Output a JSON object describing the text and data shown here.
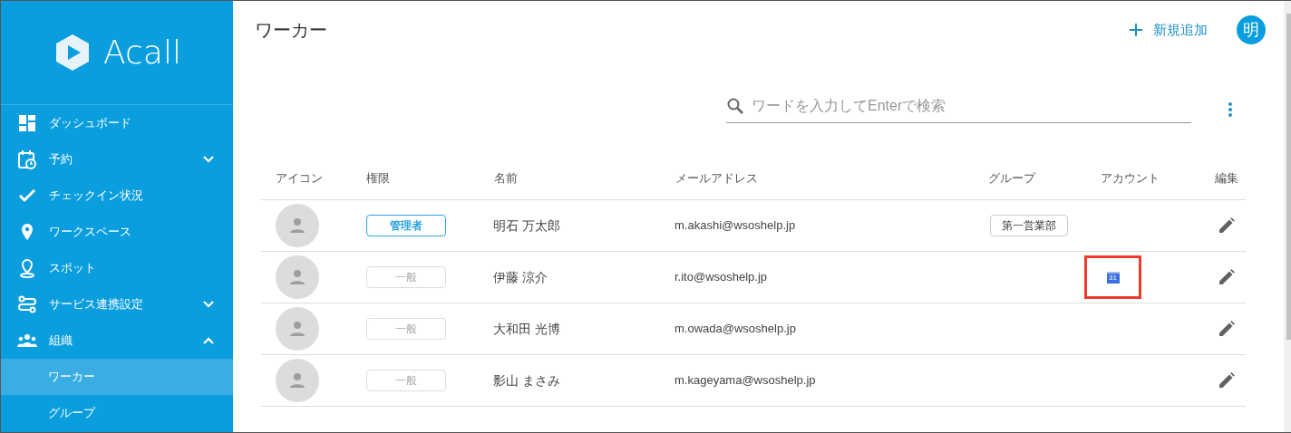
{
  "sidebar": {
    "logo": {
      "text": "Acall"
    },
    "items": [
      {
        "label": "ダッシュボード",
        "selected": false
      },
      {
        "label": "予約",
        "expanded": false,
        "selected": false
      },
      {
        "label": "チェックイン状況",
        "selected": false
      },
      {
        "label": "ワークスペース",
        "selected": false
      },
      {
        "label": "スポット",
        "selected": false
      },
      {
        "label": "サービス連携設定",
        "expanded": false,
        "selected": false
      },
      {
        "label": "組織",
        "expanded": true,
        "selected": false,
        "children": [
          {
            "label": "ワーカー",
            "selected": true
          },
          {
            "label": "グループ",
            "selected": false
          }
        ]
      }
    ]
  },
  "header": {
    "title": "ワーカー",
    "add_button": "新規追加",
    "user_avatar": "明"
  },
  "search": {
    "placeholder": "ワードを入力してEnterで検索"
  },
  "table": {
    "columns": [
      "アイコン",
      "権限",
      "名前",
      "メールアドレス",
      "グループ",
      "アカウント",
      "編集"
    ],
    "rows": [
      {
        "role": "管理者",
        "admin": true,
        "name": "明石 万太郎",
        "email": "m.akashi@wsoshelp.jp",
        "group": "第一営業部"
      },
      {
        "role": "一般",
        "admin": false,
        "name": "伊藤 涼介",
        "email": "r.ito@wsoshelp.jp",
        "account": {
          "kind": "calendar",
          "label": "31",
          "highlighted": true
        }
      },
      {
        "role": "一般",
        "admin": false,
        "name": "大和田 光博",
        "email": "m.owada@wsoshelp.jp"
      },
      {
        "role": "一般",
        "admin": false,
        "name": "影山 まさみ",
        "email": "m.kageyama@wsoshelp.jp"
      }
    ]
  }
}
